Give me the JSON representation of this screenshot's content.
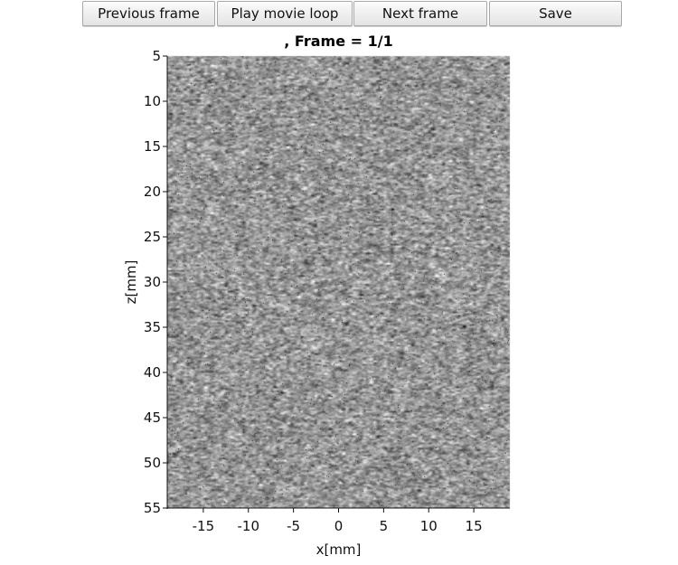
{
  "toolbar": {
    "previous_label": "Previous frame",
    "play_label": "Play movie loop",
    "next_label": "Next frame",
    "save_label": "Save"
  },
  "figure": {
    "title": ", Frame = 1/1"
  },
  "chart_data": {
    "type": "heatmap",
    "title": ", Frame = 1/1",
    "xlabel": "x[mm]",
    "ylabel": "z[mm]",
    "xlim": [
      -19,
      19
    ],
    "ylim": [
      5,
      55
    ],
    "y_inverted": true,
    "xticks": [
      -15,
      -10,
      -5,
      0,
      5,
      10,
      15
    ],
    "yticks": [
      5,
      10,
      15,
      20,
      25,
      30,
      35,
      40,
      45,
      50,
      55
    ],
    "colormap": "gray",
    "content": "B-mode ultrasound speckle image",
    "grid": false,
    "colors": {
      "axis": "#111111",
      "speckle_mid": "#9a9a9a"
    }
  }
}
